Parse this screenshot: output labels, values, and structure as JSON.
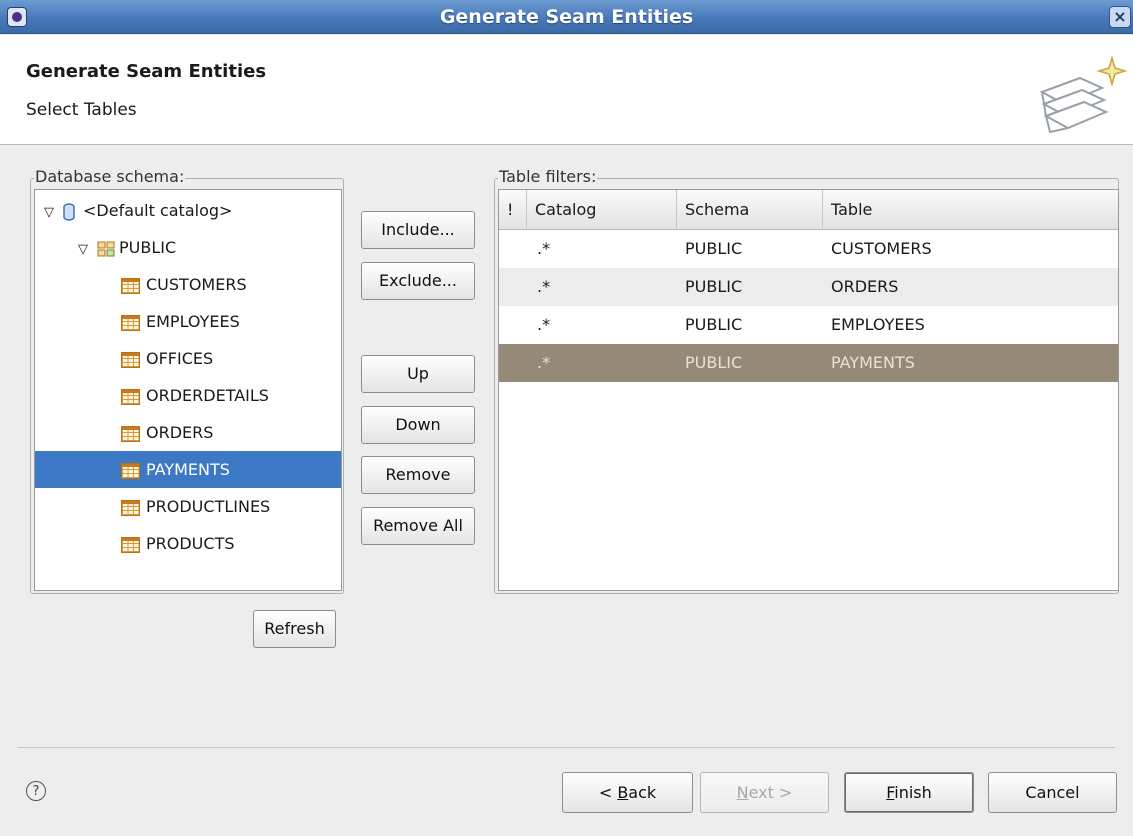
{
  "window": {
    "title": "Generate Seam Entities",
    "close": "×"
  },
  "header": {
    "title": "Generate Seam Entities",
    "subtitle": "Select Tables"
  },
  "schema_group": {
    "label": "Database schema:",
    "catalog": "<Default catalog>",
    "schema": "PUBLIC",
    "tables": [
      "CUSTOMERS",
      "EMPLOYEES",
      "OFFICES",
      "ORDERDETAILS",
      "ORDERS",
      "PAYMENTS",
      "PRODUCTLINES",
      "PRODUCTS"
    ],
    "selected_table": "PAYMENTS",
    "refresh_label": "Refresh"
  },
  "middle_buttons": {
    "include": "Include...",
    "exclude": "Exclude...",
    "up": "Up",
    "down": "Down",
    "remove": "Remove",
    "remove_all": "Remove All"
  },
  "filters_group": {
    "label": "Table filters:",
    "columns": [
      "!",
      "Catalog",
      "Schema",
      "Table"
    ],
    "rows": [
      {
        "flag": "",
        "catalog": ".*",
        "schema": "PUBLIC",
        "table": "CUSTOMERS"
      },
      {
        "flag": "",
        "catalog": ".*",
        "schema": "PUBLIC",
        "table": "ORDERS"
      },
      {
        "flag": "",
        "catalog": ".*",
        "schema": "PUBLIC",
        "table": "EMPLOYEES"
      },
      {
        "flag": "",
        "catalog": ".*",
        "schema": "PUBLIC",
        "table": "PAYMENTS"
      }
    ],
    "selected_row_index": 3
  },
  "footer": {
    "help": "?",
    "back": {
      "mnemonic": "B",
      "rest": "ack",
      "prefix": "< "
    },
    "next": {
      "mnemonic": "N",
      "rest": "ext >"
    },
    "finish": {
      "mnemonic": "F",
      "rest": "inish"
    },
    "cancel": "Cancel"
  },
  "colors": {
    "titlebar": "#4677b6",
    "tree_selection": "#3c78c4",
    "table_selection": "#958a77"
  },
  "icons": {
    "catalog": "database-icon",
    "schema": "schema-icon",
    "table": "table-icon",
    "help": "help-icon",
    "banner": "wizard-banner-icon"
  }
}
